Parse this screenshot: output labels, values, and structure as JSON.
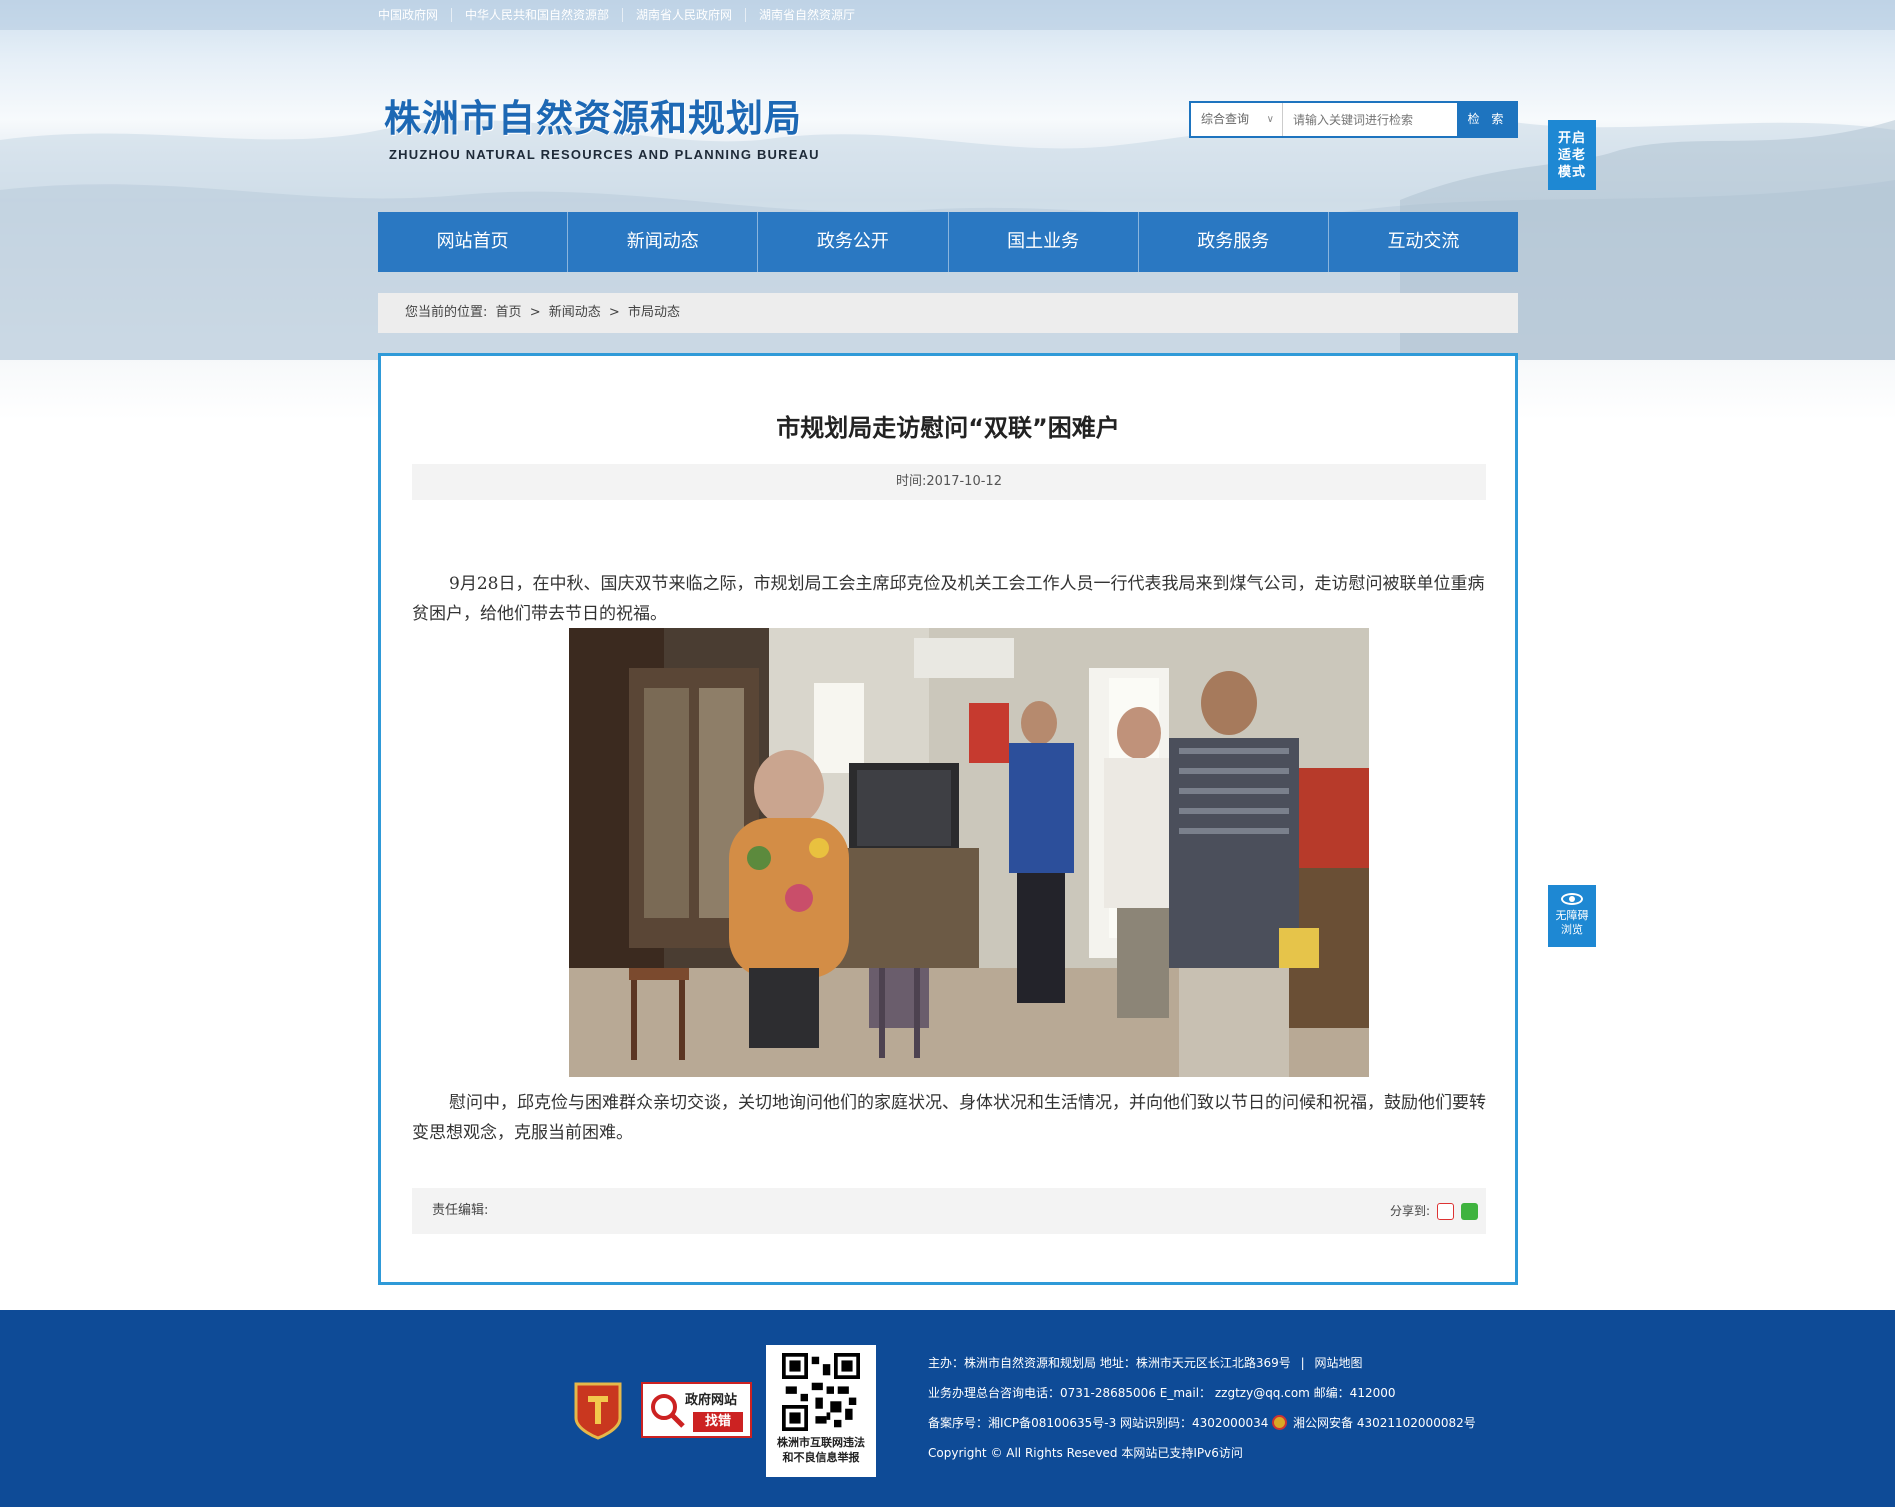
{
  "top_links": [
    "中国政府网",
    "中华人民共和国自然资源部",
    "湖南省人民政府网",
    "湖南省自然资源厅"
  ],
  "logo": {
    "cn": "株洲市自然资源和规划局",
    "en": "ZHUZHOU NATURAL RESOURCES AND PLANNING BUREAU"
  },
  "search": {
    "scope": "综合查询",
    "arrow": "∨",
    "placeholder": "请输入关键词进行检索",
    "button": "检 索"
  },
  "elder_mode": [
    "开启",
    "适老",
    "模式"
  ],
  "nav": [
    "网站首页",
    "新闻动态",
    "政务公开",
    "国土业务",
    "政务服务",
    "互动交流"
  ],
  "breadcrumb": {
    "label": "您当前的位置:",
    "items": [
      "首页",
      "新闻动态",
      "市局动态"
    ],
    "sep": ">"
  },
  "article": {
    "title": "市规划局走访慰问“双联”困难户",
    "meta": "时间:2017-10-12",
    "p1": "9月28日，在中秋、国庆双节来临之际，市规划局工会主席邱克俭及机关工会工作人员一行代表我局来到煤气公司，走访慰问被联单位重病贫困户，给他们带去节日的祝福。",
    "p2": "慰问中，邱克俭与困难群众亲切交谈，关切地询问他们的家庭状况、身体状况和生活情况，并向他们致以节日的问候和祝福，鼓励他们要转变思想观念，克服当前困难。",
    "editor": "责任编辑:",
    "share": "分享到:"
  },
  "accessibility": [
    "无障碍",
    "浏览"
  ],
  "footer": {
    "zfzc": {
      "t1": "政府网站",
      "t2": "找错"
    },
    "qr_caption": [
      "株洲市互联网违法",
      "和不良信息举报"
    ],
    "line1": "主办：株洲市自然资源和规划局  地址：株洲市天元区长江北路369号",
    "line1_sep": "|",
    "line1_link": "网站地图",
    "line2": "业务办理总台咨询电话：0731-28685006    E_mail：   zzgtzy@qq.com    邮编：412000",
    "line3a": "备案序号：湘ICP备08100635号-3  网站识别码：4302000034",
    "line3b": "湘公网安备 43021102000082号",
    "line4": "Copyright © All Rights Reseved 本网站已支持IPv6访问"
  },
  "colors": {
    "nav": "#2a78c2",
    "accent": "#2f9ad8",
    "footer": "#0e4b97",
    "button": "#1e74bf"
  }
}
